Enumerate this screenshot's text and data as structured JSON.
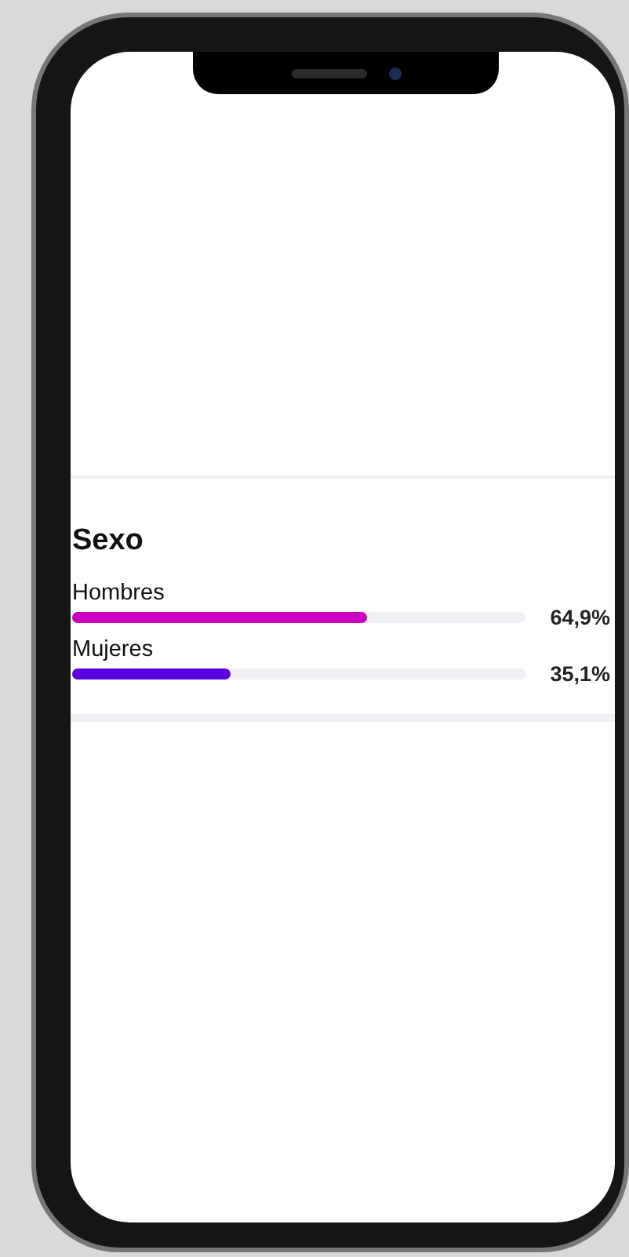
{
  "section": {
    "title": "Sexo",
    "rows": [
      {
        "label": "Hombres",
        "level": 0.649,
        "reading": "64,9%",
        "color": "#cc00c0"
      },
      {
        "label": "Mujeres",
        "level": 0.351,
        "reading": "35,1%",
        "color": "#5a00e0"
      }
    ]
  }
}
